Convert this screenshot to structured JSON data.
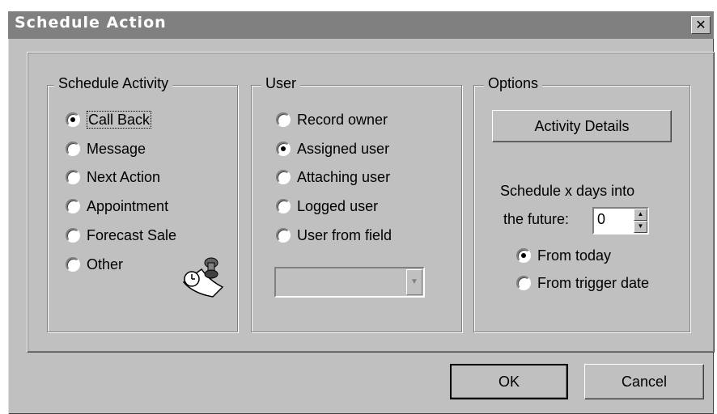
{
  "window": {
    "title": "Schedule Action",
    "close_glyph": "✕"
  },
  "schedule_activity": {
    "legend": "Schedule Activity",
    "options": [
      {
        "label": "Call Back",
        "selected": true
      },
      {
        "label": "Message",
        "selected": false
      },
      {
        "label": "Next Action",
        "selected": false
      },
      {
        "label": "Appointment",
        "selected": false
      },
      {
        "label": "Forecast Sale",
        "selected": false
      },
      {
        "label": "Other",
        "selected": false
      }
    ],
    "icon": "calendar-clock-icon"
  },
  "user": {
    "legend": "User",
    "options": [
      {
        "label": "Record owner",
        "selected": false
      },
      {
        "label": "Assigned user",
        "selected": true
      },
      {
        "label": "Attaching user",
        "selected": false
      },
      {
        "label": "Logged user",
        "selected": false
      },
      {
        "label": "User from field",
        "selected": false
      }
    ],
    "field_select_value": ""
  },
  "options": {
    "legend": "Options",
    "activity_details_label": "Activity Details",
    "schedule_label_line1": "Schedule x days into",
    "schedule_label_line2": "the future:",
    "days_value": "0",
    "from_options": [
      {
        "label": "From today",
        "selected": true
      },
      {
        "label": "From trigger date",
        "selected": false
      }
    ]
  },
  "footer": {
    "ok_label": "OK",
    "cancel_label": "Cancel"
  }
}
